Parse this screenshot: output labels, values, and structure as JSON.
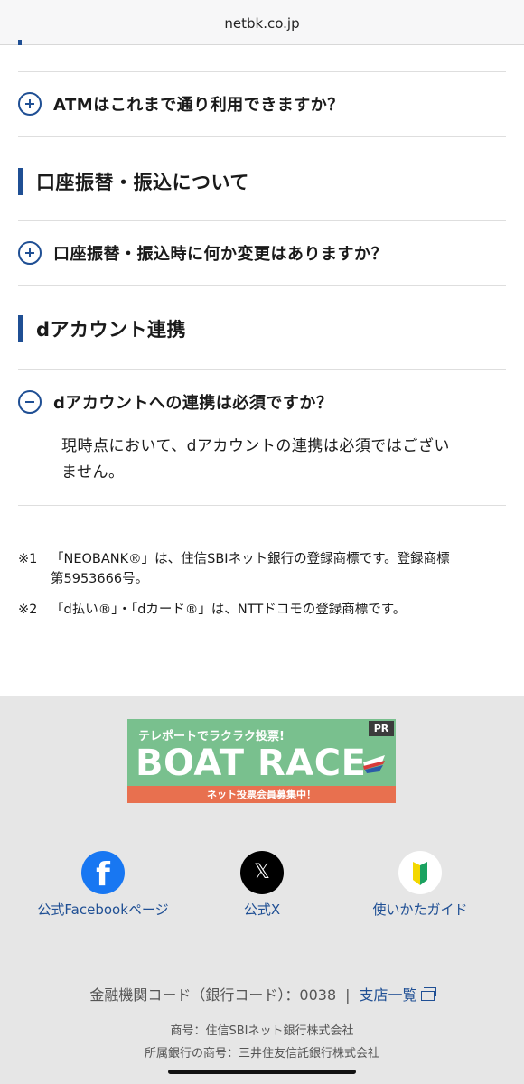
{
  "browser": {
    "url": "netbk.co.jp"
  },
  "faq_atm": {
    "question": "ATMはこれまで通り利用できますか？",
    "state": "collapsed"
  },
  "section_transfer": {
    "title": "口座振替・振込について"
  },
  "faq_transfer": {
    "question": "口座振替・振込時に何か変更はありますか？",
    "state": "collapsed"
  },
  "section_daccount": {
    "title": "dアカウント連携"
  },
  "faq_daccount": {
    "question": "dアカウントへの連携は必須ですか？",
    "state": "expanded",
    "answer_line1": "現時点において、dアカウントの連携は必須ではござい",
    "answer_line2": "ません。"
  },
  "notes": [
    {
      "mark": "※1",
      "line1": "「NEOBANK®」は、住信SBIネット銀行の登録商標です。登録商標",
      "line2": "第5953666号。"
    },
    {
      "mark": "※2",
      "line1": "「d払い®」・「dカード®」は、NTTドコモの登録商標です。"
    }
  ],
  "banner": {
    "tagline": "テレポートでラクラク投票!",
    "pr": "PR",
    "headline": "BOAT RACE",
    "strip": "ネット投票会員募集中！",
    "colors": {
      "background": "#79c08e",
      "strip": "#e8704f"
    }
  },
  "social": {
    "facebook": {
      "label": "公式Facebookページ",
      "icon": "facebook-icon",
      "color": "#1877f2"
    },
    "x": {
      "label": "公式X",
      "icon": "x-icon"
    },
    "guide": {
      "label": "使いかたガイド",
      "icon": "beginner-mark-icon"
    }
  },
  "footer": {
    "bank_code": "金融機関コード（銀行コード）：0038",
    "separator": "|",
    "branch_link": "支店一覧",
    "company_name": "商号：住信SBIネット銀行株式会社",
    "parent_bank": "所属銀行の商号：三井住友信託銀行株式会社"
  },
  "colors": {
    "accent": "#1f4f94",
    "footer_bg": "#e6e6e6"
  }
}
